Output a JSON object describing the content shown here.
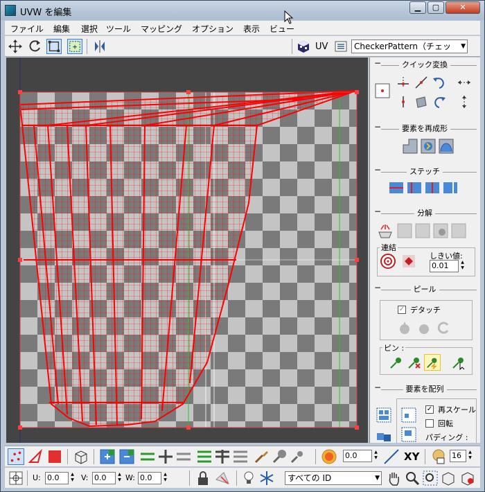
{
  "window": {
    "title": "UVW を編集"
  },
  "menu": [
    "ファイル",
    "編集",
    "選択",
    "ツール",
    "マッピング",
    "オプション",
    "表示",
    "ビュー"
  ],
  "toolbar": {
    "uv_label": "UV",
    "texture_dropdown": "CheckerPattern（チェッ"
  },
  "panel": {
    "quick_transform": "クイック変換",
    "reshape": "要素を再成形",
    "stitch": "ステッチ",
    "explode": "分解",
    "weld_group": "連結",
    "threshold_label": "しきい値:",
    "threshold_value": "0.01",
    "peel": "ピール",
    "detach_label": "デタッチ",
    "pins_group": "ピン :",
    "arrange": "要素を配列",
    "rescale_label": "再スケール",
    "rotate_label": "回転",
    "padding_label": "パディング :"
  },
  "bottom": {
    "value1": "0.0",
    "xy_label": "XY",
    "value2": "16",
    "u_label": "U:",
    "u_value": "0.0",
    "v_label": "V:",
    "v_value": "0.0",
    "w_label": "W:",
    "w_value": "0.0",
    "id_dropdown": "すべての ID"
  },
  "colors": {
    "wire": "#ff0000",
    "checker_dark": "#7a7a7a",
    "checker_light": "#c4c4c4",
    "bg": "#444444"
  }
}
